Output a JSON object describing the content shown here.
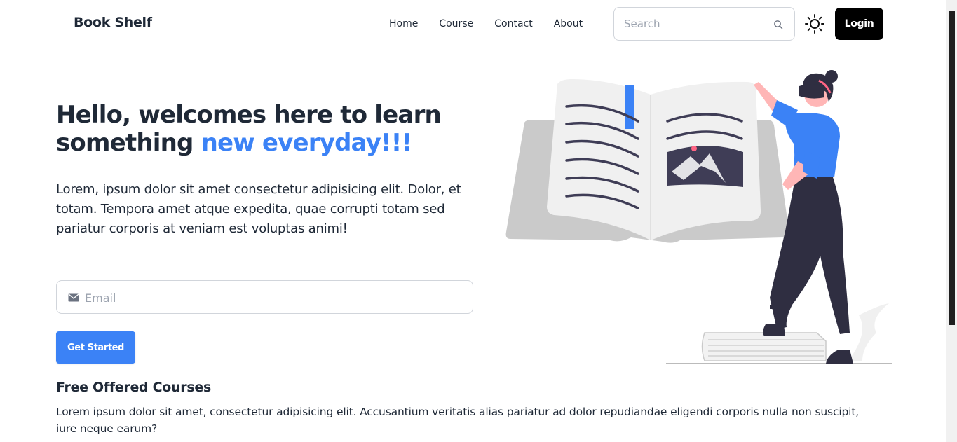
{
  "brand": {
    "name": "Book Shelf"
  },
  "nav": {
    "links": [
      {
        "label": "Home"
      },
      {
        "label": "Course"
      },
      {
        "label": "Contact"
      },
      {
        "label": "About"
      }
    ],
    "search_placeholder": "Search",
    "login_label": "Login"
  },
  "hero": {
    "title_part1": "Hello, welcomes here to learn something ",
    "title_accent": "new everyday!!!",
    "text": "Lorem, ipsum dolor sit amet consectetur adipisicing elit. Dolor, et totam. Tempora amet atque expedita, quae corrupti totam sed pariatur corporis at veniam est voluptas animi!",
    "email_placeholder": "Email",
    "cta_label": "Get Started"
  },
  "courses": {
    "title": "Free Offered Courses",
    "text": "Lorem ipsum dolor sit amet, consectetur adipisicing elit. Accusantium veritatis alias pariatur ad dolor repudiandae eligendi corporis nulla non suscipit, iure neque earum?"
  },
  "colors": {
    "accent": "#3b82f6",
    "text": "#1f2937",
    "login_bg": "#000000"
  },
  "icons": {
    "search": "search-icon",
    "theme": "sun-icon",
    "mail": "mail-icon"
  }
}
